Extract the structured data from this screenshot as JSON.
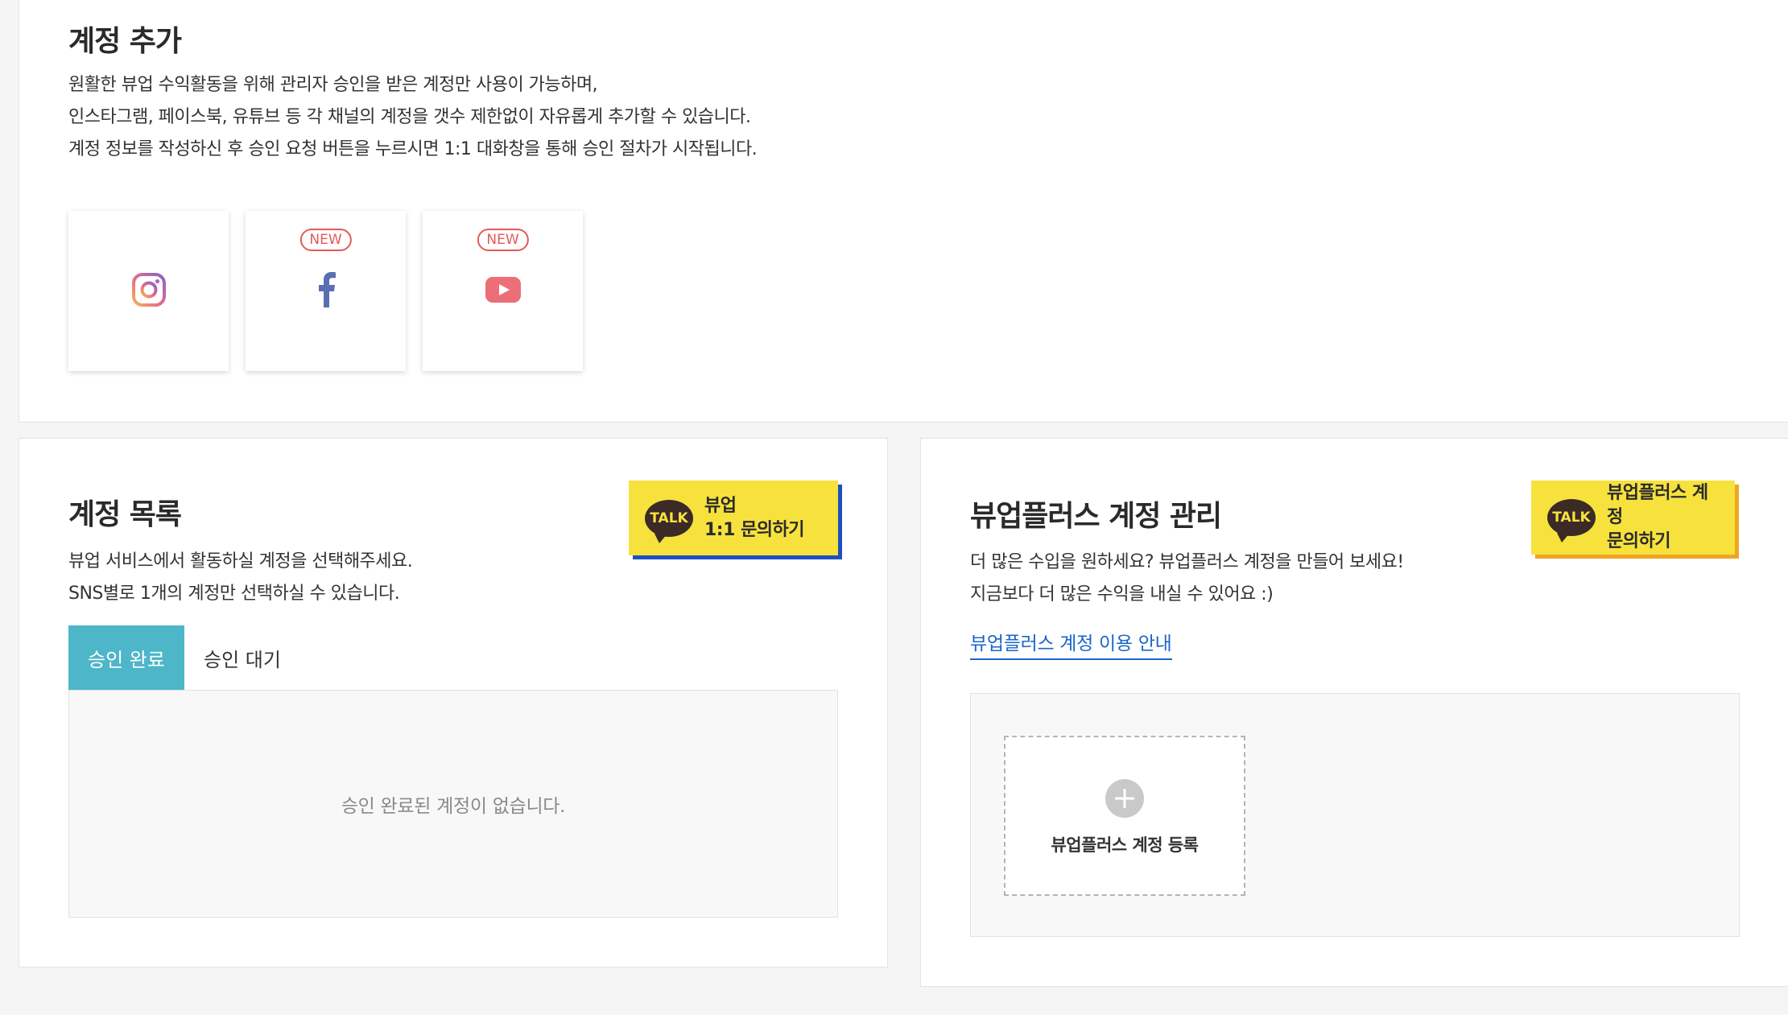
{
  "add_section": {
    "title": "계정 추가",
    "desc_lines": [
      "원활한 뷰업 수익활동을 위해 관리자 승인을 받은 계정만 사용이 가능하며,",
      "인스타그램, 페이스북, 유튜브 등 각 채널의 계정을 갯수 제한없이 자유롭게 추가할 수 있습니다.",
      "계정 정보를 작성하신 후 승인 요청 버튼을 누르시면 1:1 대화창을 통해 승인 절차가 시작됩니다."
    ],
    "sns_cards": [
      {
        "icon": "instagram-icon",
        "badge": ""
      },
      {
        "icon": "facebook-icon",
        "badge": "NEW"
      },
      {
        "icon": "youtube-icon",
        "badge": "NEW"
      }
    ]
  },
  "list_section": {
    "title": "계정 목록",
    "desc_lines": [
      "뷰업 서비스에서 활동하실 계정을 선택해주세요.",
      "SNS별로 1개의 계정만 선택하실 수 있습니다."
    ],
    "talk_button": {
      "bubble": "TALK",
      "label": "뷰업\n1:1 문의하기"
    },
    "tabs": [
      {
        "label": "승인 완료",
        "active": true
      },
      {
        "label": "승인 대기",
        "active": false
      }
    ],
    "empty_message": "승인 완료된 계정이 없습니다."
  },
  "plus_section": {
    "title": "뷰업플러스 계정 관리",
    "desc_lines": [
      "더 많은 수입을 원하세요? 뷰업플러스 계정을 만들어 보세요!",
      "지금보다 더 많은 수익을 내실 수 있어요 :)"
    ],
    "talk_button": {
      "bubble": "TALK",
      "label": "뷰업플러스 계정\n문의하기"
    },
    "guide_link": "뷰업플러스 계정 이용 안내",
    "register_label": "뷰업플러스 계정 등록"
  },
  "colors": {
    "accent_teal": "#4db6c8",
    "kakao_yellow": "#f7e23d",
    "badge_red": "#e4595b",
    "link_blue": "#1a66c8"
  }
}
